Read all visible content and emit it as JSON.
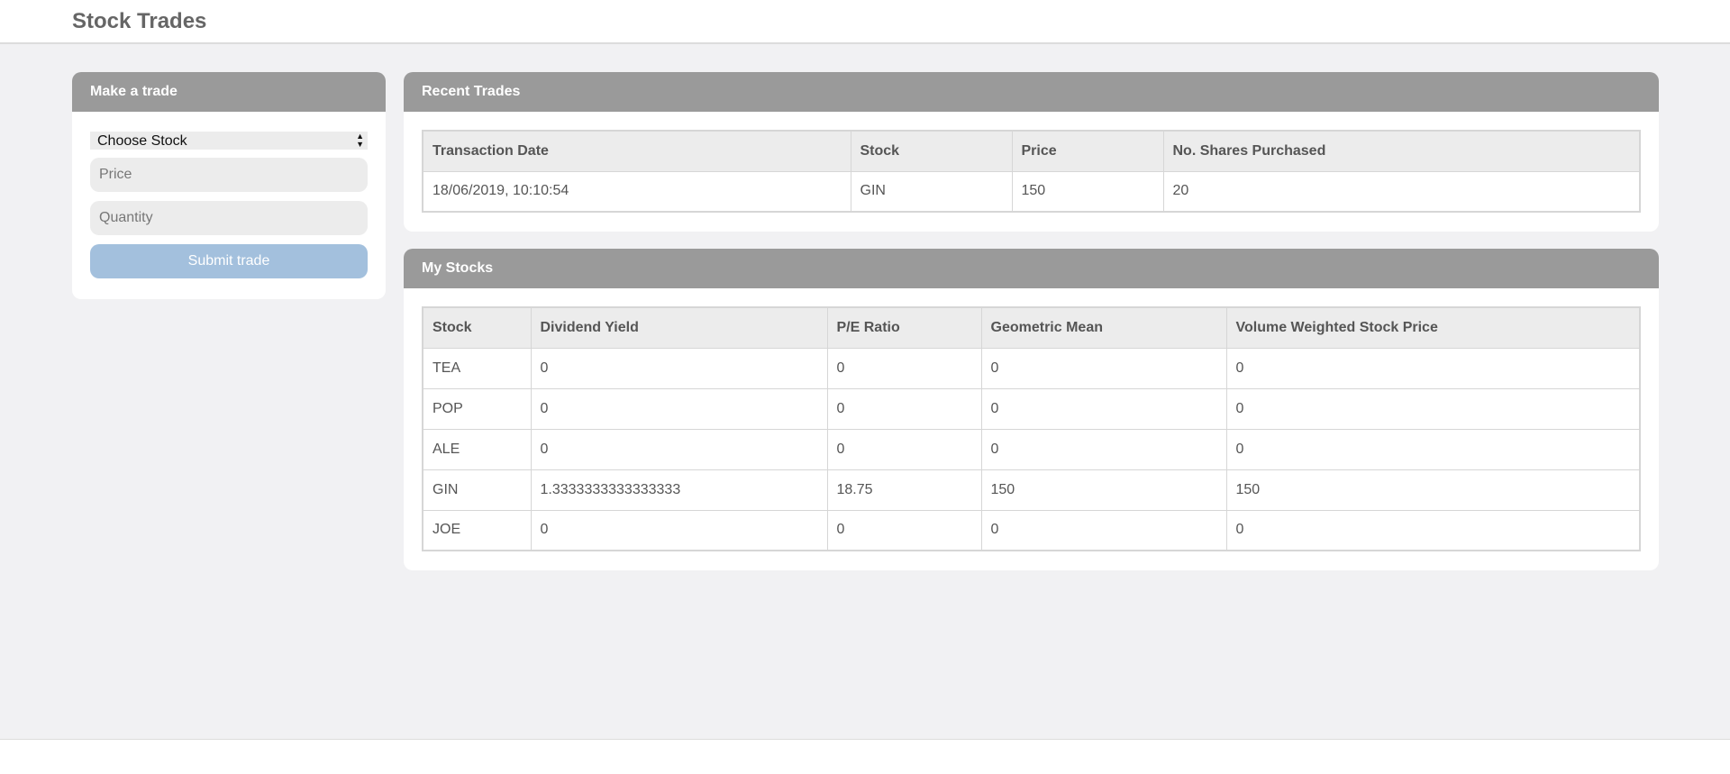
{
  "app": {
    "title": "Stock Trades"
  },
  "trade_form": {
    "header": "Make a trade",
    "stock_select": {
      "selected": "Choose Stock",
      "options": [
        "Choose Stock"
      ]
    },
    "price_placeholder": "Price",
    "quantity_placeholder": "Quantity",
    "submit_label": "Submit trade"
  },
  "recent_trades": {
    "header": "Recent Trades",
    "columns": [
      "Transaction Date",
      "Stock",
      "Price",
      "No. Shares Purchased"
    ],
    "rows": [
      [
        "18/06/2019, 10:10:54",
        "GIN",
        "150",
        "20"
      ]
    ]
  },
  "my_stocks": {
    "header": "My Stocks",
    "columns": [
      "Stock",
      "Dividend Yield",
      "P/E Ratio",
      "Geometric Mean",
      "Volume Weighted Stock Price"
    ],
    "rows": [
      [
        "TEA",
        "0",
        "0",
        "0",
        "0"
      ],
      [
        "POP",
        "0",
        "0",
        "0",
        "0"
      ],
      [
        "ALE",
        "0",
        "0",
        "0",
        "0"
      ],
      [
        "GIN",
        "1.3333333333333333",
        "18.75",
        "150",
        "150"
      ],
      [
        "JOE",
        "0",
        "0",
        "0",
        "0"
      ]
    ]
  },
  "colors": {
    "panel_header": "#9a9a9a",
    "submit_button": "#a3c0dd",
    "background": "#f1f1f3"
  }
}
